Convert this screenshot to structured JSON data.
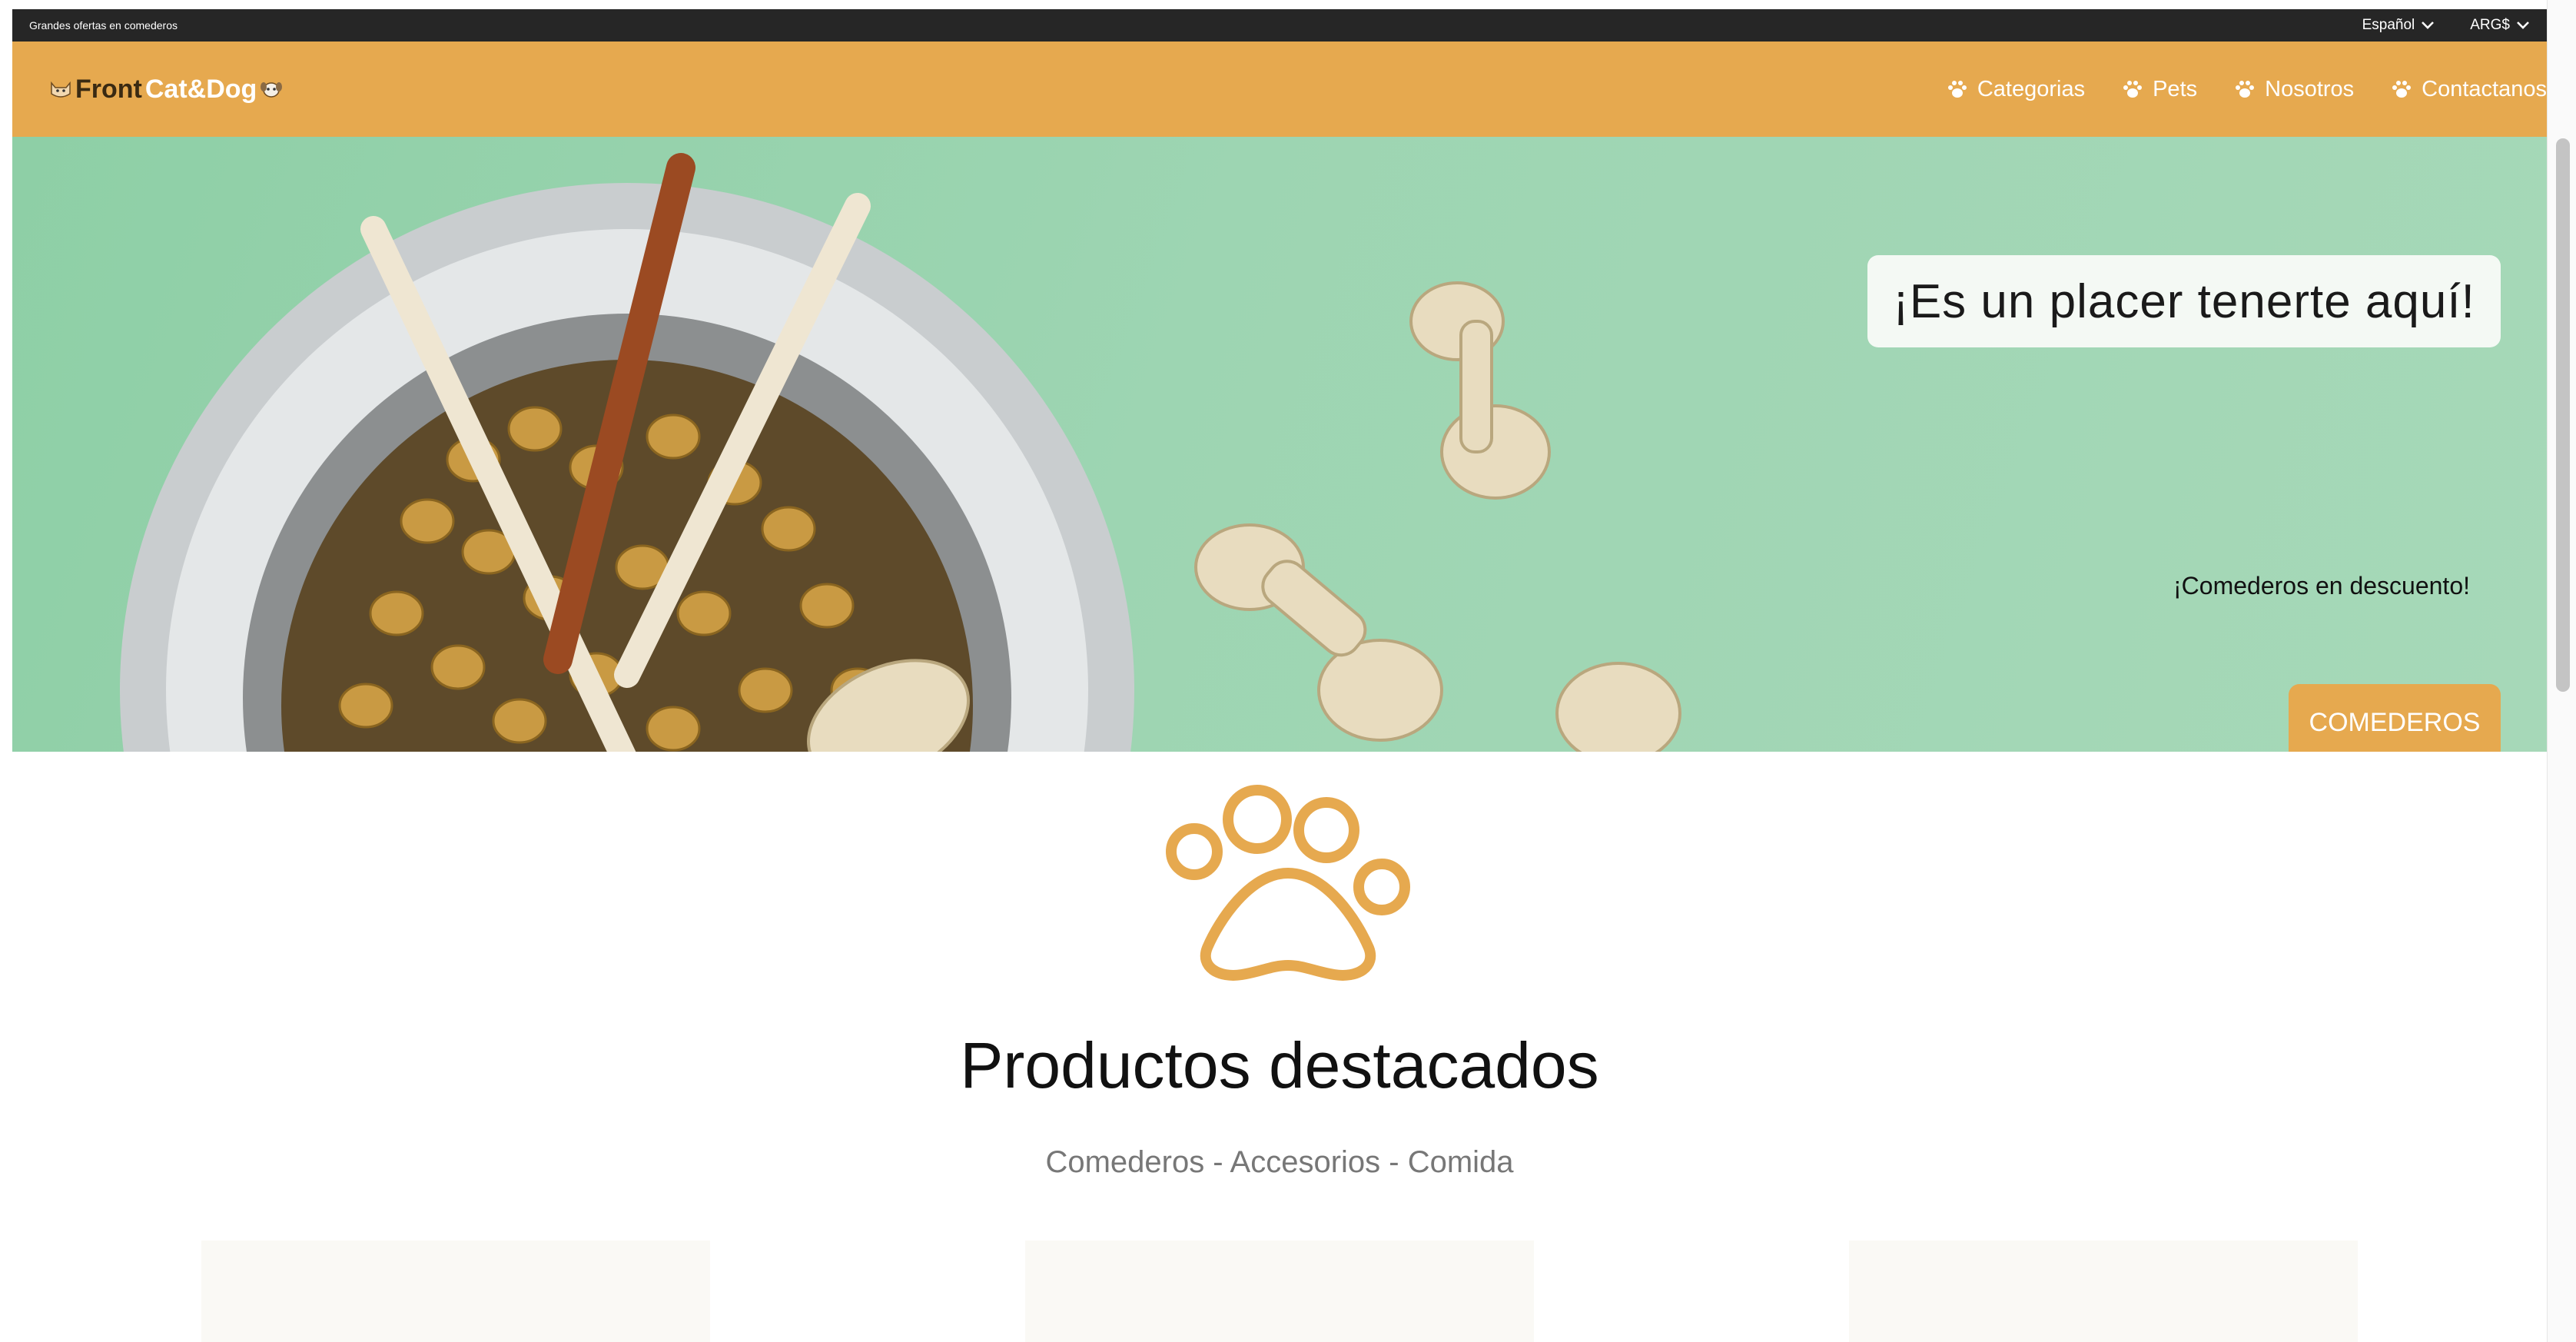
{
  "topbar": {
    "promo": "Grandes ofertas en comederos",
    "language": "Español",
    "currency": "ARG$"
  },
  "header": {
    "logo_part1": "Front",
    "logo_part2": "Cat&Dog",
    "nav": [
      {
        "label": "Categorias",
        "icon": "paw-icon"
      },
      {
        "label": "Pets",
        "icon": "paw-icon"
      },
      {
        "label": "Nosotros",
        "icon": "paw-icon"
      },
      {
        "label": "Contactanos",
        "icon": "paw-icon"
      }
    ]
  },
  "hero": {
    "heading": "¡Es un placer tenerte aquí!",
    "subtitle": "¡Comederos en descuento!",
    "cta": "COMEDEROS"
  },
  "featured": {
    "title": "Productos destacados",
    "subtitle": "Comederos - Accesorios - Comida",
    "cards": 3
  },
  "colors": {
    "accent": "#e6a94f",
    "topbar": "#262626",
    "hero_bg": "#9dd5b2",
    "card_bg": "#faf9f5"
  }
}
